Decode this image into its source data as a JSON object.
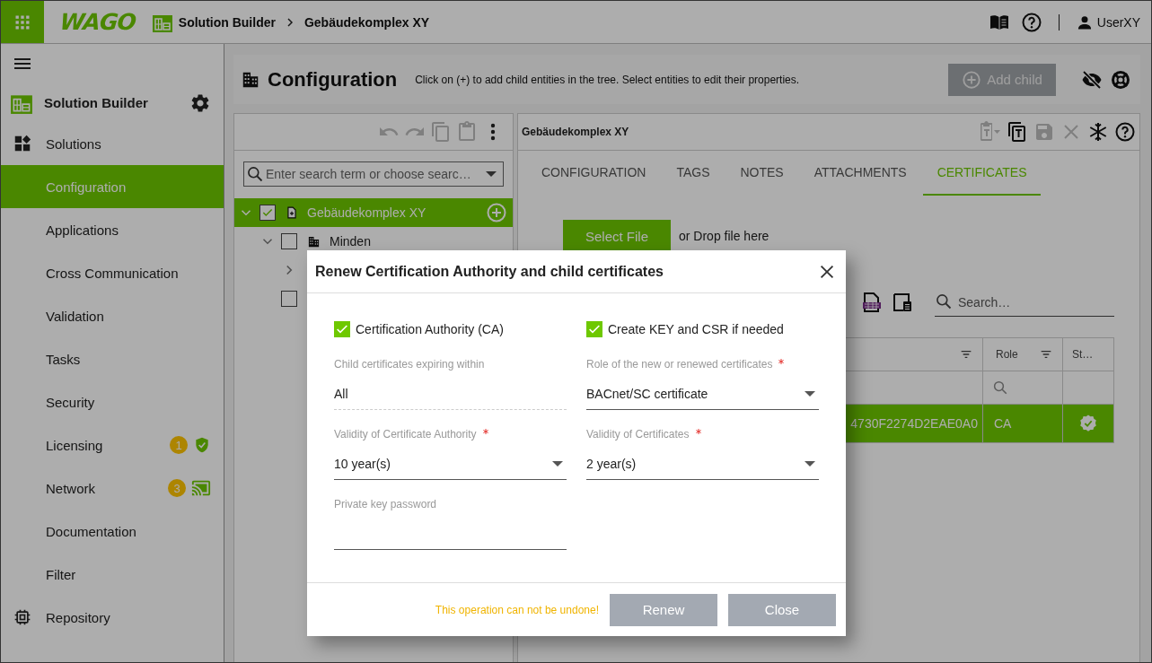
{
  "top_bar": {
    "logo": "WAGO",
    "breadcrumb": [
      "Solution Builder",
      "Gebäudekomplex XY"
    ],
    "user": "UserXY"
  },
  "sidebar": {
    "title": "Solution Builder",
    "items": [
      {
        "label": "Solutions",
        "kind": "solutions",
        "selected": false
      },
      {
        "label": "Configuration",
        "kind": "entry",
        "selected": true
      },
      {
        "label": "Applications",
        "kind": "entry",
        "selected": false
      },
      {
        "label": "Cross Communication",
        "kind": "entry",
        "selected": false
      },
      {
        "label": "Validation",
        "kind": "entry",
        "selected": false
      },
      {
        "label": "Tasks",
        "kind": "entry",
        "selected": false
      },
      {
        "label": "Security",
        "kind": "entry",
        "selected": false
      },
      {
        "label": "Licensing",
        "kind": "licensing",
        "badge": "1",
        "selected": false
      },
      {
        "label": "Network",
        "kind": "network",
        "badge": "3",
        "selected": false
      },
      {
        "label": "Documentation",
        "kind": "entry",
        "selected": false
      },
      {
        "label": "Filter",
        "kind": "entry",
        "selected": false
      },
      {
        "label": "Repository",
        "kind": "repository",
        "selected": false
      }
    ]
  },
  "header": {
    "title": "Configuration",
    "hint": "Click on (+) to add child entities in the tree. Select entities to edit their properties.",
    "add_button": {
      "label": "Add child",
      "disabled": true
    }
  },
  "tree": {
    "toolbar": [
      {
        "kind": "undo",
        "disabled": true
      },
      {
        "kind": "redo",
        "disabled": true
      },
      {
        "kind": "copy",
        "disabled": true
      },
      {
        "kind": "paste",
        "disabled": true
      },
      {
        "kind": "more",
        "disabled": false
      }
    ],
    "search_placeholder": "Enter search term or choose searc…",
    "nodes": [
      {
        "label": "Gebäudekomplex XY",
        "kind": "complex",
        "selected": true,
        "checked": true,
        "expanded": true,
        "children": [
          {
            "label": "Minden",
            "kind": "site",
            "selected": false,
            "checked": false,
            "expanded": true,
            "children": [
              {
                "selected": false,
                "expanded": false
              }
            ]
          },
          {
            "selected": false,
            "checked": false
          }
        ]
      }
    ]
  },
  "details": {
    "title": "Gebäudekomplex XY",
    "toolbar": [
      {
        "kind": "paste-menu",
        "disabled": true
      },
      {
        "kind": "copy-template",
        "disabled": false
      },
      {
        "kind": "save",
        "disabled": true
      },
      {
        "kind": "close",
        "disabled": true
      },
      {
        "kind": "freeze",
        "disabled": false
      },
      {
        "kind": "help",
        "disabled": false
      }
    ],
    "tabs": [
      {
        "label": "CONFIGURATION",
        "selected": false
      },
      {
        "label": "TAGS",
        "selected": false
      },
      {
        "label": "NOTES",
        "selected": false
      },
      {
        "label": "ATTACHMENTS",
        "selected": false
      },
      {
        "label": "CERTIFICATES",
        "selected": true
      }
    ],
    "select_file": "Select File",
    "drop_hint": "or Drop file here",
    "search_placeholder": "Search…",
    "table": {
      "columns": [
        {
          "filter": true,
          "searchable": false
        },
        {
          "label": "Role",
          "filter": true,
          "searchable": true
        },
        {
          "label": "St…",
          "filter": false,
          "searchable": false
        }
      ],
      "rows": [
        {
          "cells": [
            "4730F2274D2EAE0A0",
            "CA"
          ],
          "selected": true
        }
      ]
    }
  },
  "dialog": {
    "title": "Renew Certification Authority and child certificates",
    "controls": [
      {
        "kind": "checkbox",
        "label": "Certification Authority (CA)",
        "checked": true
      },
      {
        "kind": "checkbox",
        "label": "Create KEY and CSR if needed",
        "checked": true
      },
      {
        "kind": "static",
        "label": "Child certificates expiring within",
        "value": "All",
        "required": false
      },
      {
        "kind": "select",
        "label": "Role of the new or renewed certificates",
        "value": "BACnet/SC certificate",
        "required": true
      },
      {
        "kind": "select",
        "label": "Validity of Certificate Authority",
        "value": "10 year(s)",
        "required": true
      },
      {
        "kind": "select",
        "label": "Validity of Certificates",
        "value": "2 year(s)",
        "required": true
      },
      {
        "kind": "password",
        "label": "Private key password",
        "required": false
      }
    ],
    "warning": "This operation can not be undone!",
    "buttons": [
      "Renew",
      "Close"
    ]
  }
}
